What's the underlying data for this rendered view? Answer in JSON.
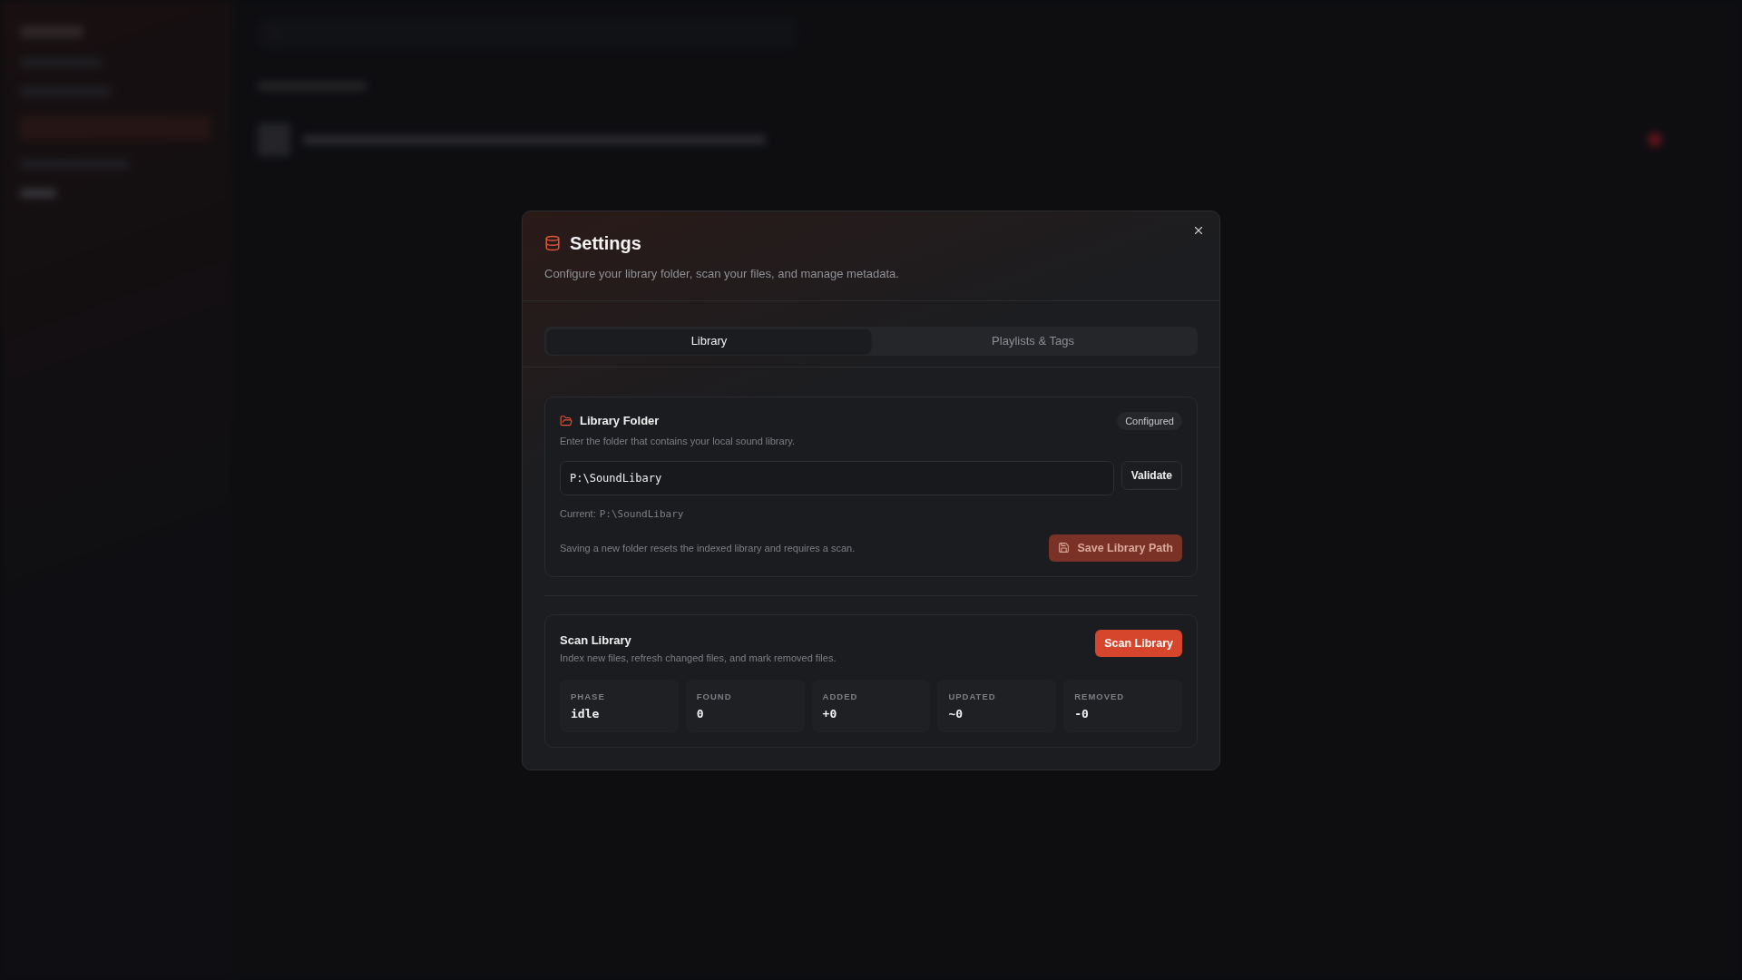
{
  "dialog": {
    "title": "Settings",
    "subtitle": "Configure your library folder, scan your files, and manage metadata.",
    "tabs": [
      {
        "label": "Library",
        "selected": true
      },
      {
        "label": "Playlists & Tags",
        "selected": false
      }
    ],
    "library_folder": {
      "title": "Library Folder",
      "description": "Enter the folder that contains your local sound library.",
      "badge": "Configured",
      "path_field": {
        "value": "P:\\SoundLibary"
      },
      "validate_button": "Validate",
      "current_label": "Current:",
      "current_value": "P:\\SoundLibary",
      "note": "Saving a new folder resets the indexed library and requires a scan.",
      "save_button": {
        "label": "Save Library Path",
        "disabled": true
      }
    },
    "scan_library": {
      "title": "Scan Library",
      "description": "Index new files, refresh changed files, and mark removed files.",
      "button": "Scan Library",
      "stats": [
        {
          "label": "PHASE",
          "value": "idle"
        },
        {
          "label": "FOUND",
          "value": "0"
        },
        {
          "label": "ADDED",
          "value": "+0"
        },
        {
          "label": "UPDATED",
          "value": "~0"
        },
        {
          "label": "REMOVED",
          "value": "-0"
        }
      ]
    }
  }
}
